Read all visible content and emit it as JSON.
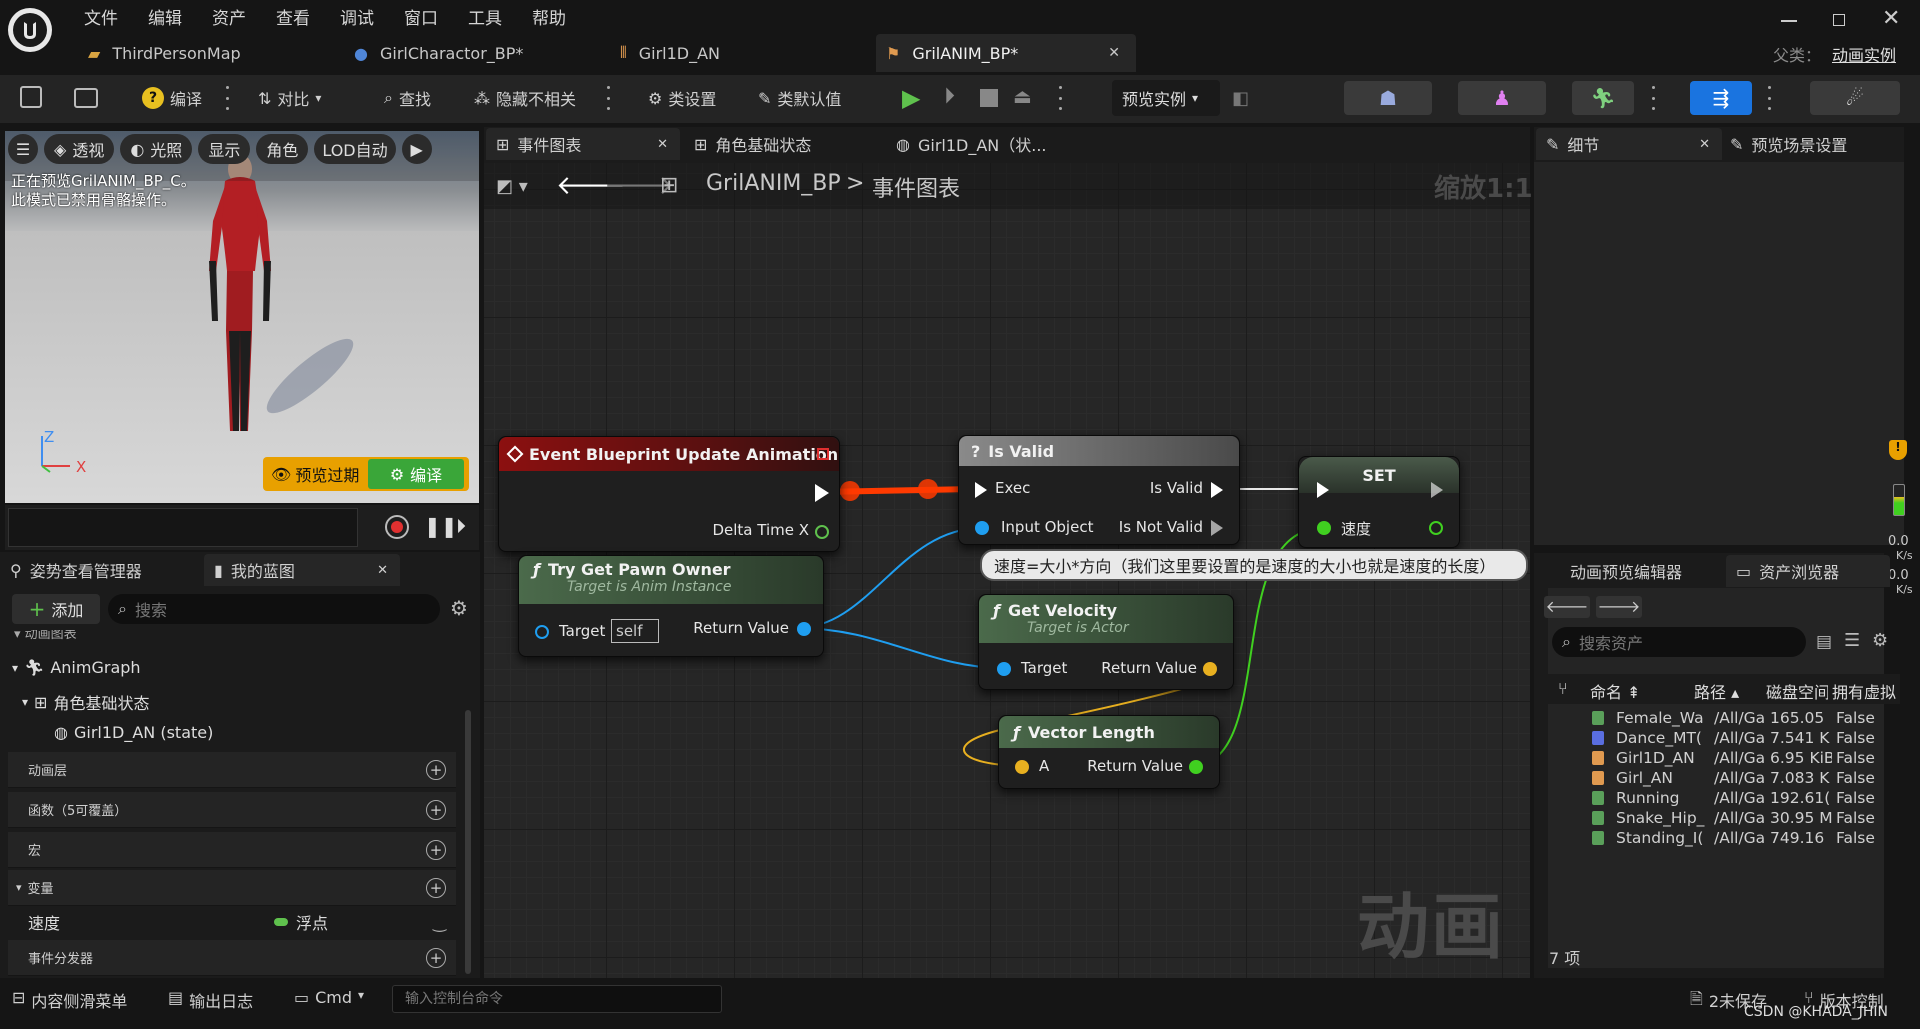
{
  "menu": [
    "文件",
    "编辑",
    "资产",
    "查看",
    "调试",
    "窗口",
    "工具",
    "帮助"
  ],
  "doc_tabs": [
    {
      "label": "ThirdPersonMap",
      "icon": "map-icon"
    },
    {
      "label": "GirlCharactor_BP*",
      "icon": "blueprint-icon"
    },
    {
      "label": "Girl1D_AN",
      "icon": "blendspace-icon"
    },
    {
      "label": "GrilANIM_BP*",
      "icon": "animbp-icon"
    }
  ],
  "parent_class": {
    "label": "父类：",
    "value": "动画实例"
  },
  "toolbar": {
    "compile": "编译",
    "diff": "对比",
    "find": "查找",
    "hide_unrelated": "隐藏不相关",
    "class_settings": "类设置",
    "class_defaults": "类默认值",
    "preview_instance": "预览实例"
  },
  "viewport": {
    "buttons": [
      "透视",
      "光照",
      "显示",
      "角色",
      "LOD自动"
    ],
    "info_line1": "正在预览GrilANIM_BP_C。",
    "info_line2": "此模式已禁用骨骼操作。",
    "axis_z": "Z",
    "axis_x": "X",
    "preview_outdated": "预览过期",
    "compile": "编译"
  },
  "graph_tabs": [
    "事件图表",
    "角色基础状态",
    "Girl1D_AN（状..."
  ],
  "breadcrumb": {
    "root": "GrilANIM_BP",
    "current": "事件图表"
  },
  "zoom": "缩放1:1",
  "watermark": "动画",
  "nodes": {
    "event": {
      "title": "Event Blueprint Update Animation",
      "pin": "Delta Time X"
    },
    "pawn": {
      "title": "Try Get Pawn Owner",
      "subtitle": "Target is Anim Instance",
      "target": "Target",
      "target_value": "self",
      "return": "Return Value"
    },
    "isvalid": {
      "title": "Is Valid",
      "exec": "Exec",
      "is_valid": "Is Valid",
      "input": "Input Object",
      "not_valid": "Is Not Valid"
    },
    "set": {
      "title": "SET",
      "var": "速度"
    },
    "velocity": {
      "title": "Get Velocity",
      "subtitle": "Target is Actor",
      "target": "Target",
      "return": "Return Value"
    },
    "vlength": {
      "title": "Vector Length",
      "a": "A",
      "return": "Return Value"
    }
  },
  "comment": "速度=大小*方向（我们这里要设置的是速度的大小也就是速度的长度）",
  "left_panel": {
    "tabs": [
      "姿势查看管理器",
      "我的蓝图"
    ],
    "add": "添加",
    "search_placeholder": "搜索",
    "anim_graph_header": "动画图表",
    "tree": [
      "AnimGraph",
      "角色基础状态",
      "Girl1D_AN (state)"
    ],
    "categories": [
      "动画层",
      "函数（5可覆盖）",
      "宏",
      "变量",
      "事件分发器"
    ],
    "variable": {
      "name": "速度",
      "type": "浮点"
    }
  },
  "right_panel": {
    "tabs": [
      "细节",
      "预览场景设置"
    ],
    "bottom_tabs": [
      "动画预览编辑器",
      "资产浏览器"
    ],
    "search_placeholder": "搜索资产",
    "columns": [
      "命名",
      "路径",
      "磁盘空间",
      "拥有虚拟"
    ],
    "assets": [
      {
        "name": "Female_Wa",
        "path": "/All/Ga",
        "size": "165.05",
        "virt": "False",
        "color": "#5aa05a"
      },
      {
        "name": "Dance_MT(",
        "path": "/All/Ga",
        "size": "7.541 K",
        "virt": "False",
        "color": "#5a6ee0"
      },
      {
        "name": "Girl1D_AN",
        "path": "/All/Ga",
        "size": "6.95 KiB",
        "virt": "False",
        "color": "#e09a50"
      },
      {
        "name": "Girl_AN",
        "path": "/All/Ga",
        "size": "7.083 K",
        "virt": "False",
        "color": "#e09a50"
      },
      {
        "name": "Running",
        "path": "/All/Ga",
        "size": "192.61(",
        "virt": "False",
        "color": "#5aa05a"
      },
      {
        "name": "Snake_Hip_",
        "path": "/All/Ga",
        "size": "30.95 M",
        "virt": "False",
        "color": "#5aa05a"
      },
      {
        "name": "Standing_I(",
        "path": "/All/Ga",
        "size": "749.16",
        "virt": "False",
        "color": "#5aa05a"
      }
    ],
    "count": "7 项"
  },
  "side_stats": {
    "v1": "0.0",
    "u1": "K/s",
    "v2": "0.0",
    "u2": "K/s"
  },
  "status_bar": {
    "content_drawer": "内容侧滑菜单",
    "output_log": "输出日志",
    "cmd": "Cmd",
    "console_placeholder": "输入控制台命令",
    "unsaved": "2未保存",
    "source_control": "版本控制",
    "credit": "CSDN @KHADA_JHIN"
  }
}
